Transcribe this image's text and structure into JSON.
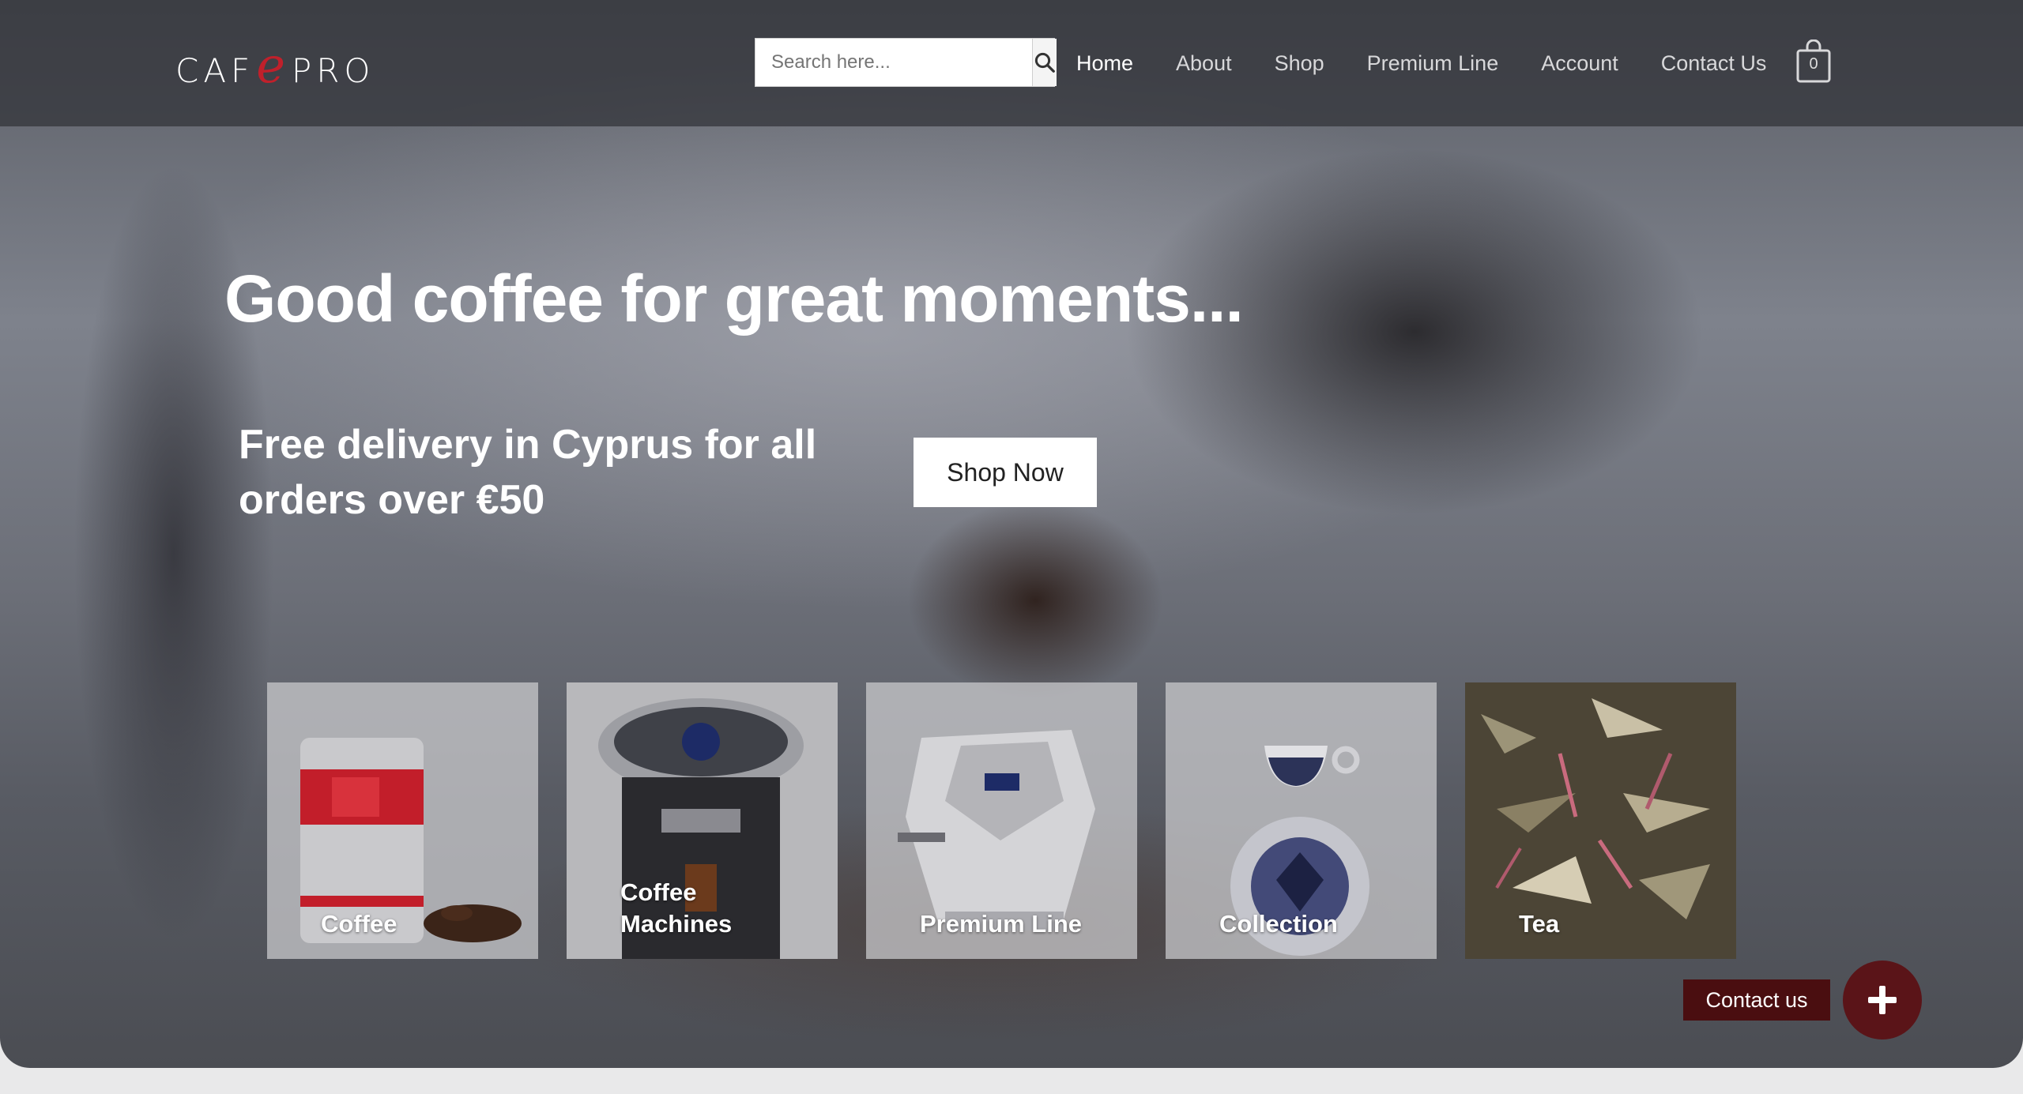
{
  "brand": {
    "logo_part1": "CAF",
    "logo_e": "e",
    "logo_part2": "PRO"
  },
  "search": {
    "placeholder": "Search here...",
    "icon": "search-icon"
  },
  "nav": {
    "items": [
      {
        "label": "Home",
        "active": true
      },
      {
        "label": "About"
      },
      {
        "label": "Shop"
      },
      {
        "label": "Premium Line"
      },
      {
        "label": "Account"
      },
      {
        "label": "Contact Us"
      }
    ]
  },
  "cart": {
    "count": "0",
    "icon": "shopping-bag-icon"
  },
  "hero": {
    "title": "Good coffee for great moments...",
    "subtitle": "Free delivery in Cyprus for all orders over €50",
    "cta_label": "Shop Now"
  },
  "categories": [
    {
      "label": "Coffee"
    },
    {
      "label": "Coffee Machines"
    },
    {
      "label": "Premium Line"
    },
    {
      "label": "Collection"
    },
    {
      "label": "Tea"
    }
  ],
  "contact_widget": {
    "label": "Contact us",
    "icon": "plus-icon",
    "color": "#5a1418"
  },
  "colors": {
    "accent": "#c0202b",
    "contact_dark": "#4a0e10"
  }
}
